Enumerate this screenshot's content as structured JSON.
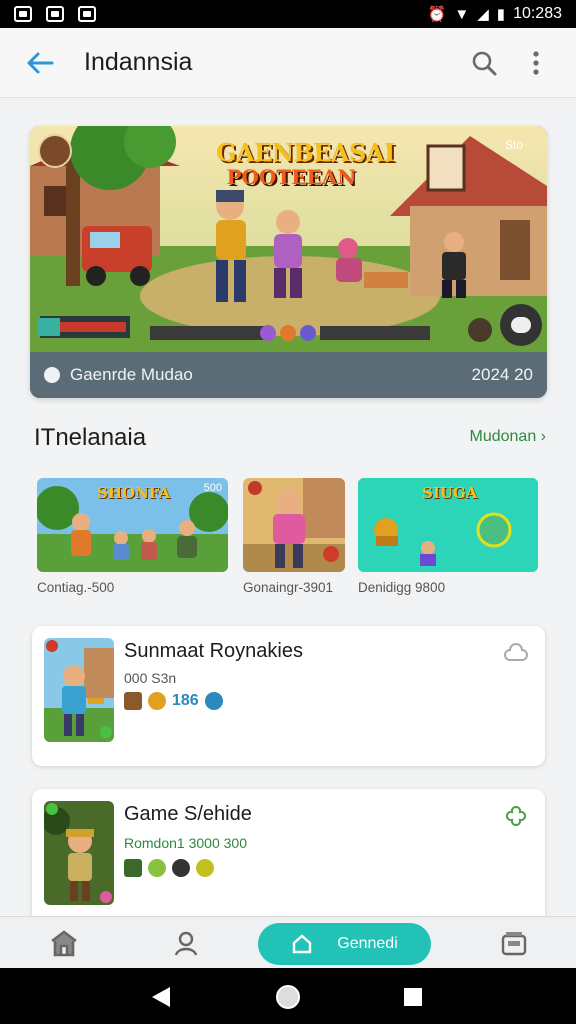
{
  "status_bar": {
    "time": "10:283"
  },
  "app_bar": {
    "title": "Indannsia"
  },
  "hero": {
    "title_line1": "GAENBEASAI",
    "title_line2": "POOTEEAN",
    "badge": "Sto",
    "caption": "Gaenrde Mudao",
    "date": "2024 20"
  },
  "section": {
    "title": "ITnelanaia",
    "more": "Mudonan"
  },
  "small_cards": [
    {
      "art_title": "SHONFA",
      "art_badge": "500",
      "label": "Contiag.-500"
    },
    {
      "art_title": "",
      "art_badge": "",
      "label": "Gonaingr-3901"
    },
    {
      "art_title": "SIUGA",
      "art_badge": "",
      "label": "Denidigg 9800"
    }
  ],
  "list_items": [
    {
      "title": "Sunmaat Roynakies",
      "subtitle": "000 S3n",
      "number": "186"
    },
    {
      "title": "Game S/ehide",
      "subtitle": "Romdon1 3000 300",
      "number": ""
    }
  ],
  "bottom_nav": {
    "pill_label": "Gennedi"
  },
  "colors": {
    "accent_teal": "#22c2b6",
    "link_green": "#2c8a3c",
    "back_blue": "#2a9ad6"
  },
  "icons": [
    "back-arrow-icon",
    "search-icon",
    "more-vert-icon",
    "home-icon",
    "profile-icon",
    "library-icon",
    "gamepad-icon"
  ]
}
